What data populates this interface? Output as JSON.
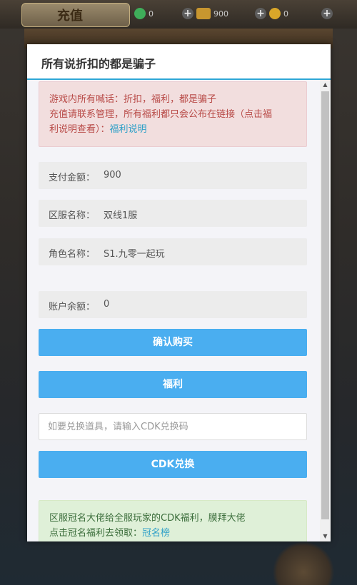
{
  "game": {
    "title": "充值",
    "resources": [
      {
        "icon": "jade-coin-icon",
        "color": "#3fae5a",
        "value": "0"
      },
      {
        "icon": "gold-ingot-icon",
        "color": "#c8962f",
        "value": "900"
      },
      {
        "icon": "gold-coin-icon",
        "color": "#d9a629",
        "value": "0"
      }
    ]
  },
  "modal": {
    "title": "所有说折扣的都是骗子",
    "accent_color": "#2ea7d6",
    "warning": {
      "line1": "游戏内所有喊话：折扣，福利，都是骗子",
      "line2": "充值请联系管理，所有福利都只会公布在链接（点击福",
      "line3_prefix": "利说明查看）：",
      "link_text": "福利说明"
    },
    "fields": {
      "pay_amount_label": "支付金额：",
      "pay_amount_value": "900",
      "server_label": "区服名称：",
      "server_value": "双线1服",
      "role_label": "角色名称：",
      "role_value": "S1.九零一起玩",
      "balance_label": "账户余额：",
      "balance_value": "0"
    },
    "buttons": {
      "confirm_label": "确认购买",
      "welfare_label": "福利",
      "cdk_label": "CDK兑换",
      "color": "#4aaef0"
    },
    "cdk_input": {
      "placeholder": "如要兑换道具，请输入CDK兑换码",
      "value": ""
    },
    "notice": {
      "line1": "区服冠名大佬给全服玩家的CDK福利，膜拜大佬",
      "line2_prefix": "点击冠名福利去领取：",
      "link_text": "冠名榜"
    }
  }
}
